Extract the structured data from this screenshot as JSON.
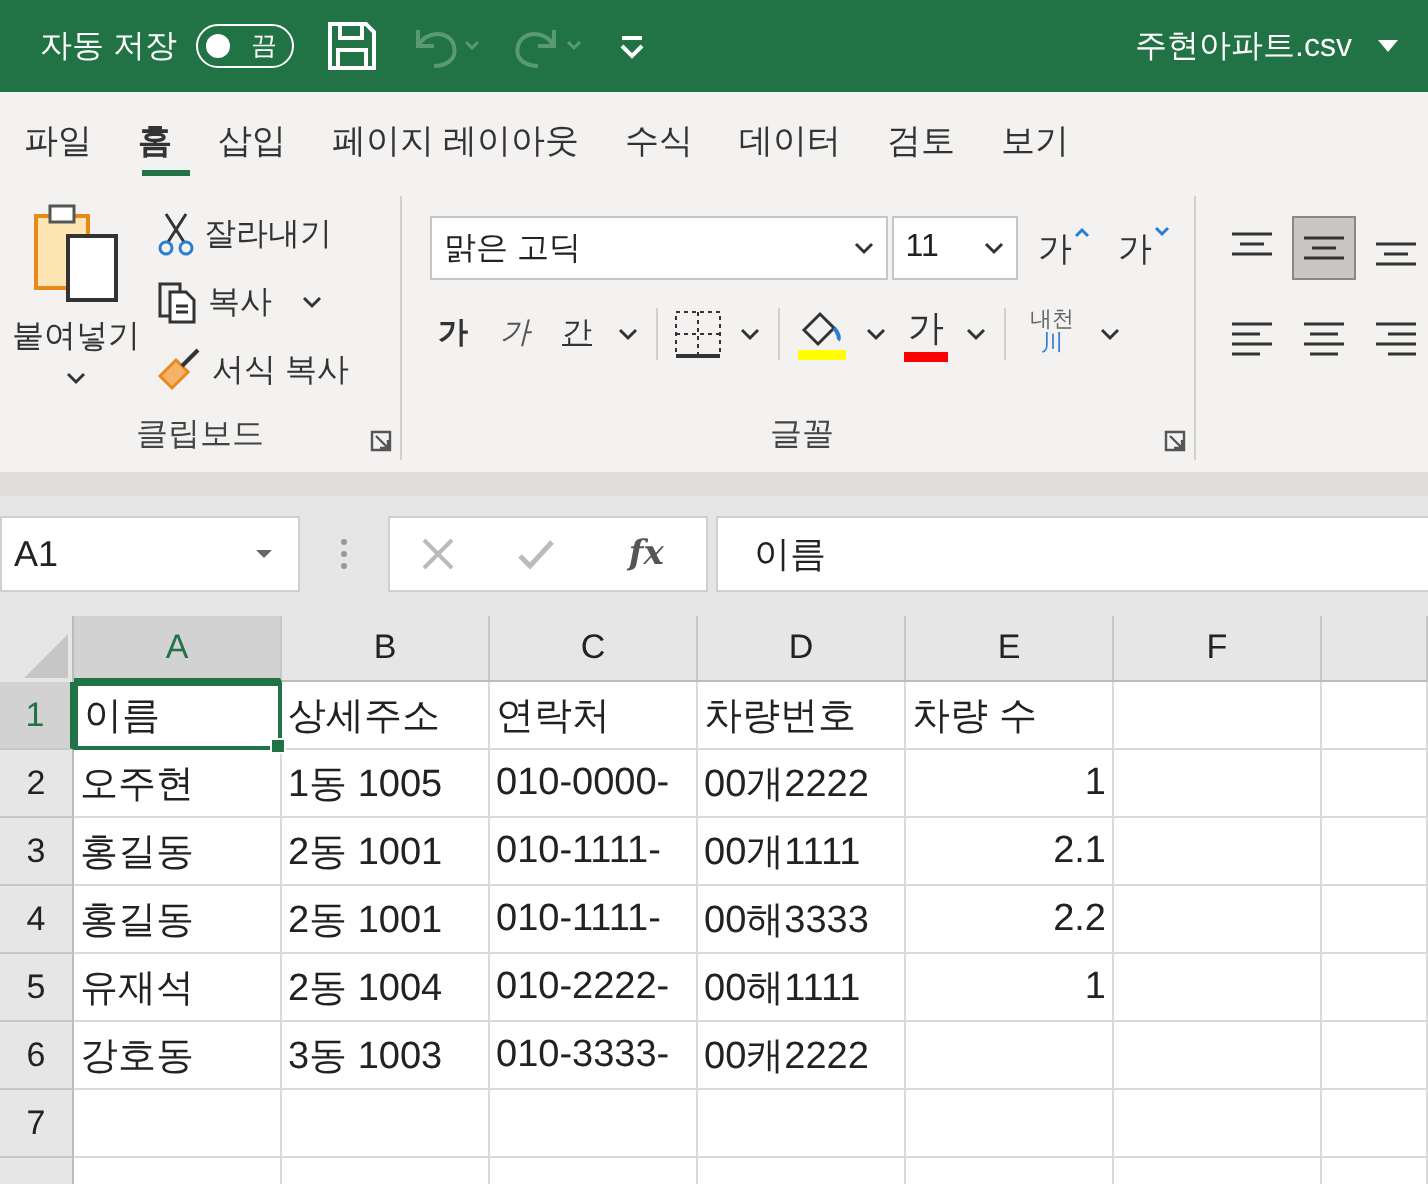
{
  "title_bar": {
    "autosave_label": "자동 저장",
    "autosave_on": false,
    "autosave_state": "끔",
    "file_name": "주현아파트.csv"
  },
  "tabs": [
    {
      "label": "파일",
      "selected": false
    },
    {
      "label": "홈",
      "selected": true
    },
    {
      "label": "삽입",
      "selected": false
    },
    {
      "label": "페이지 레이아웃",
      "selected": false
    },
    {
      "label": "수식",
      "selected": false
    },
    {
      "label": "데이터",
      "selected": false
    },
    {
      "label": "검토",
      "selected": false
    },
    {
      "label": "보기",
      "selected": false
    }
  ],
  "ribbon": {
    "clipboard": {
      "paste": "붙여넣기",
      "cut": "잘라내기",
      "copy": "복사",
      "format_painter": "서식 복사",
      "group_label": "클립보드"
    },
    "font": {
      "font_name": "맑은 고딕",
      "font_size": "11",
      "grow": "가",
      "shrink": "가",
      "bold": "가",
      "italic": "가",
      "underline": "간",
      "font_color": "가",
      "phonetic": "내천",
      "phonetic_hanja": "川",
      "group_label": "글꼴"
    },
    "vertical_align": [
      {
        "selected": false
      },
      {
        "selected": true
      },
      {
        "selected": false
      }
    ],
    "horizontal_align": [
      {
        "selected": false
      },
      {
        "selected": false
      },
      {
        "selected": false
      }
    ]
  },
  "formula_bar": {
    "name_box": "A1",
    "fx": "fx",
    "value": "이름"
  },
  "sheet": {
    "columns": [
      {
        "label": "A",
        "selected": true
      },
      {
        "label": "B",
        "selected": false
      },
      {
        "label": "C",
        "selected": false
      },
      {
        "label": "D",
        "selected": false
      },
      {
        "label": "E",
        "selected": false
      },
      {
        "label": "F",
        "selected": false
      }
    ],
    "rows": [
      {
        "number": "1",
        "selected": true,
        "cells": [
          {
            "text": "이름",
            "kind": "text"
          },
          {
            "text": "상세주소",
            "kind": "text"
          },
          {
            "text": "연락처",
            "kind": "text"
          },
          {
            "text": "차량번호",
            "kind": "text"
          },
          {
            "text": "차량 수",
            "kind": "text"
          }
        ]
      },
      {
        "number": "2",
        "selected": false,
        "cells": [
          {
            "text": "오주현",
            "kind": "text"
          },
          {
            "text": "1동 1005",
            "kind": "text"
          },
          {
            "text": "010-0000-",
            "kind": "text"
          },
          {
            "text": "00개2222",
            "kind": "text"
          },
          {
            "text": "1",
            "kind": "number"
          }
        ]
      },
      {
        "number": "3",
        "selected": false,
        "cells": [
          {
            "text": "홍길동",
            "kind": "text"
          },
          {
            "text": "2동 1001",
            "kind": "text"
          },
          {
            "text": "010-1111-",
            "kind": "text"
          },
          {
            "text": "00개1111",
            "kind": "text"
          },
          {
            "text": "2.1",
            "kind": "number"
          }
        ]
      },
      {
        "number": "4",
        "selected": false,
        "cells": [
          {
            "text": "홍길동",
            "kind": "text"
          },
          {
            "text": "2동 1001",
            "kind": "text"
          },
          {
            "text": "010-1111-",
            "kind": "text"
          },
          {
            "text": "00해3333",
            "kind": "text"
          },
          {
            "text": "2.2",
            "kind": "number"
          }
        ]
      },
      {
        "number": "5",
        "selected": false,
        "cells": [
          {
            "text": "유재석",
            "kind": "text"
          },
          {
            "text": "2동 1004",
            "kind": "text"
          },
          {
            "text": "010-2222-",
            "kind": "text"
          },
          {
            "text": "00해1111",
            "kind": "text"
          },
          {
            "text": "1",
            "kind": "number"
          }
        ]
      },
      {
        "number": "6",
        "selected": false,
        "cells": [
          {
            "text": "강호동",
            "kind": "text"
          },
          {
            "text": "3동 1003",
            "kind": "text"
          },
          {
            "text": "010-3333-",
            "kind": "text"
          },
          {
            "text": "00캐2222",
            "kind": "text"
          }
        ]
      },
      {
        "number": "7",
        "selected": false
      }
    ]
  }
}
